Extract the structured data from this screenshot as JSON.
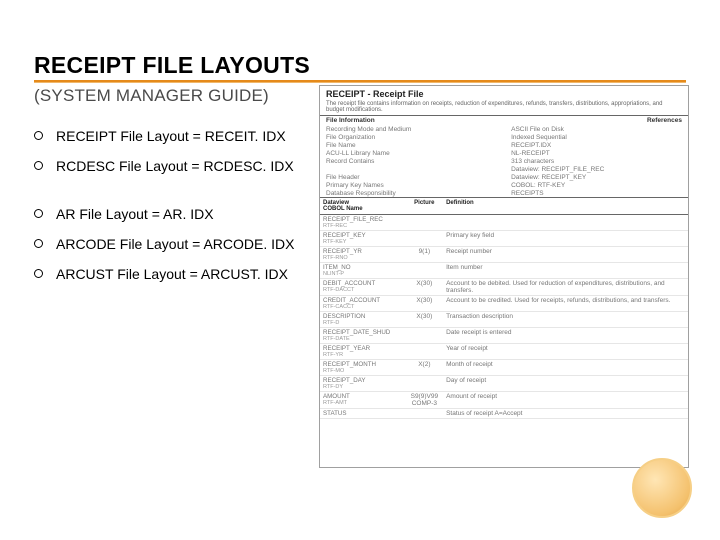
{
  "title": "RECEIPT FILE LAYOUTS",
  "subtitle": "(SYSTEM MANAGER GUIDE)",
  "bullets": [
    {
      "text": "RECEIPT File Layout = RECEIT. IDX",
      "gap": false
    },
    {
      "text": "RCDESC File Layout = RCDESC. IDX",
      "gap": false
    },
    {
      "text": "AR File Layout = AR. IDX",
      "gap": true
    },
    {
      "text": "ARCODE File Layout = ARCODE. IDX",
      "gap": false
    },
    {
      "text": "ARCUST File Layout = ARCUST. IDX",
      "gap": false
    }
  ],
  "doc": {
    "title": "RECEIPT - Receipt File",
    "description": "The receipt file contains information on receipts, reduction of expenditures, refunds, transfers, distributions, appropriations, and budget modifications.",
    "section_left": "File Information",
    "section_right": "References",
    "meta": [
      {
        "l": "Recording Mode and Medium",
        "r": "ASCII File on Disk"
      },
      {
        "l": "File Organization",
        "r": "Indexed Sequential"
      },
      {
        "l": "File Name",
        "r": "RECEIPT.IDX"
      },
      {
        "l": "ACU-LL Library Name",
        "r": "NL-RECEIPT"
      },
      {
        "l": "Record Contains",
        "r": "313 characters"
      },
      {
        "l": "",
        "r": "Dataview: RECEIPT_FILE_REC"
      },
      {
        "l": "File Header",
        "r": "Dataview: RECEIPT_KEY"
      },
      {
        "l": "Primary Key Names",
        "r": "COBOL: RTF-KEY"
      },
      {
        "l": "Database Responsibility",
        "r": "RECEIPTS"
      }
    ],
    "columns": {
      "c1": "Dataview\nCOBOL Name",
      "c2": "Picture",
      "c3": "Definition"
    },
    "rows": [
      {
        "name": "RECEIPT_FILE_REC",
        "sub": "RTF-REC",
        "pic": "",
        "def": ""
      },
      {
        "name": "RECEIPT_KEY",
        "sub": "RTF-KEY",
        "pic": "",
        "def": "Primary key field"
      },
      {
        "name": "RECEIPT_YR",
        "sub": "RTF-RNO",
        "pic": "9(1)",
        "def": "Receipt number"
      },
      {
        "name": "ITEM_NO",
        "sub": "NLINT-P",
        "pic": "",
        "def": "Item number"
      },
      {
        "name": "DEBIT_ACCOUNT",
        "sub": "RTF-DACCT",
        "pic": "X(30)",
        "def": "Account to be debited. Used for reduction of expenditures, distributions, and transfers."
      },
      {
        "name": "CREDIT_ACCOUNT",
        "sub": "RTF-CACCT",
        "pic": "X(30)",
        "def": "Account to be credited. Used for receipts, refunds, distributions, and transfers."
      },
      {
        "name": "DESCRIPTION",
        "sub": "RTF-D",
        "pic": "X(30)",
        "def": "Transaction description"
      },
      {
        "name": "RECEIPT_DATE_SHUD",
        "sub": "RTF-DATE",
        "pic": "",
        "def": "Date receipt is entered"
      },
      {
        "name": "RECEIPT_YEAR",
        "sub": "RTF-YR",
        "pic": "",
        "def": "Year of receipt"
      },
      {
        "name": "RECEIPT_MONTH",
        "sub": "RTF-MO",
        "pic": "X(2)",
        "def": "Month of receipt"
      },
      {
        "name": "RECEIPT_DAY",
        "sub": "RTF-DY",
        "pic": "",
        "def": "Day of receipt"
      },
      {
        "name": "AMOUNT",
        "sub": "RTF-AMT",
        "pic": "S9(9)V99 COMP-3",
        "def": "Amount of receipt"
      },
      {
        "name": "STATUS",
        "sub": "",
        "pic": "",
        "def": "Status of receipt\nA=Accept"
      }
    ]
  }
}
